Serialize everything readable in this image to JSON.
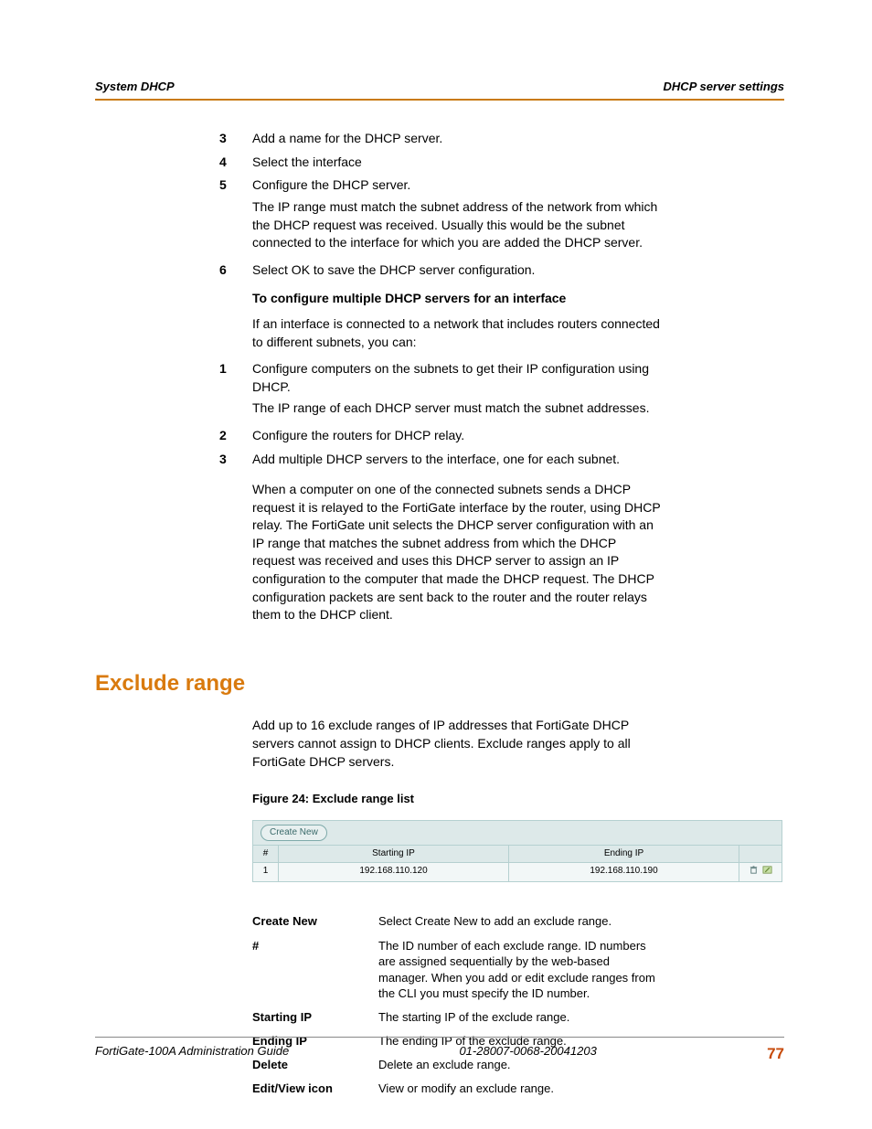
{
  "header": {
    "left": "System DHCP",
    "right": "DHCP server settings"
  },
  "steps_a": [
    {
      "n": "3",
      "text": "Add a name for the DHCP server."
    },
    {
      "n": "4",
      "text": "Select the interface"
    },
    {
      "n": "5",
      "text": "Configure the DHCP server.",
      "sub": "The IP range must match the subnet address of the network from which the DHCP request was received. Usually this would be the subnet connected to the interface for which you are added the DHCP server."
    },
    {
      "n": "6",
      "text": "Select OK to save the DHCP server configuration."
    }
  ],
  "sub_heading_a": "To configure multiple DHCP servers for an interface",
  "intro_a": "If an interface is connected to a network that includes routers connected to different subnets, you can:",
  "steps_b": [
    {
      "n": "1",
      "text": "Configure computers on the subnets to get their IP configuration using DHCP.",
      "sub": "The IP range of each DHCP server must match the subnet addresses."
    },
    {
      "n": "2",
      "text": "Configure the routers for DHCP relay."
    },
    {
      "n": "3",
      "text": "Add multiple DHCP servers to the interface, one for each subnet."
    }
  ],
  "para_b": "When a computer on one of the connected subnets sends a DHCP request it is relayed to the FortiGate interface by the router, using DHCP relay. The FortiGate unit selects the DHCP server configuration with an IP range that matches the subnet address from which the DHCP request was received and uses this DHCP server to assign an IP configuration to the computer that made the DHCP request. The DHCP configuration packets are sent back to the router and the router relays them to the DHCP client.",
  "section_title": "Exclude range",
  "exclude_intro": "Add up to 16 exclude ranges of IP addresses that FortiGate DHCP servers cannot assign to DHCP clients. Exclude ranges apply to all FortiGate DHCP servers.",
  "figure_caption": "Figure 24: Exclude range list",
  "ui": {
    "create_label": "Create New",
    "col_num": "#",
    "col_start": "Starting IP",
    "col_end": "Ending IP",
    "row": {
      "n": "1",
      "start": "192.168.110.120",
      "end": "192.168.110.190"
    }
  },
  "defs": [
    {
      "term": "Create New",
      "desc": "Select Create New to add an exclude range."
    },
    {
      "term": "#",
      "desc": "The ID number of each exclude range. ID numbers are assigned sequentially by the web-based manager. When you add or edit exclude ranges from the CLI you must specify the ID number."
    },
    {
      "term": "Starting IP",
      "desc": "The starting IP of the exclude range."
    },
    {
      "term": "Ending IP",
      "desc": "The ending IP of the exclude range."
    },
    {
      "term": "Delete",
      "desc": "Delete an exclude range."
    },
    {
      "term": "Edit/View icon",
      "desc": "View or modify an exclude range."
    }
  ],
  "footer": {
    "left": "FortiGate-100A Administration Guide",
    "mid": "01-28007-0068-20041203",
    "right": "77"
  }
}
